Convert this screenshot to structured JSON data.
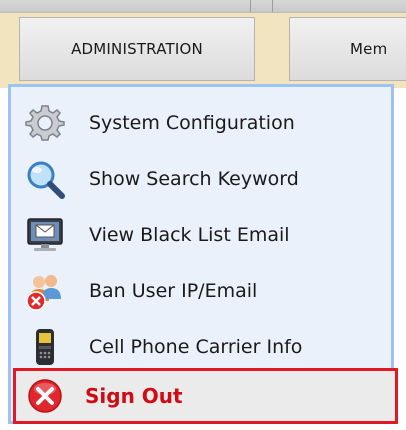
{
  "tabs": {
    "active_label": "ADMINISTRATION",
    "next_label": "Mem"
  },
  "menu": {
    "items": [
      {
        "label": "System Configuration",
        "icon": "gear-icon"
      },
      {
        "label": "Show Search Keyword",
        "icon": "magnifier-icon"
      },
      {
        "label": "View Black List Email",
        "icon": "monitor-mail-icon"
      },
      {
        "label": "Ban User IP/Email",
        "icon": "users-ban-icon"
      },
      {
        "label": "Cell Phone Carrier Info",
        "icon": "cell-phone-icon"
      },
      {
        "label": "Sign Out",
        "icon": "close-circle-icon"
      }
    ]
  },
  "colors": {
    "signout_text": "#d10a14",
    "signout_border": "#e01a24",
    "menu_border": "#9cc3f2",
    "tab_strip": "#f3e4c0"
  }
}
